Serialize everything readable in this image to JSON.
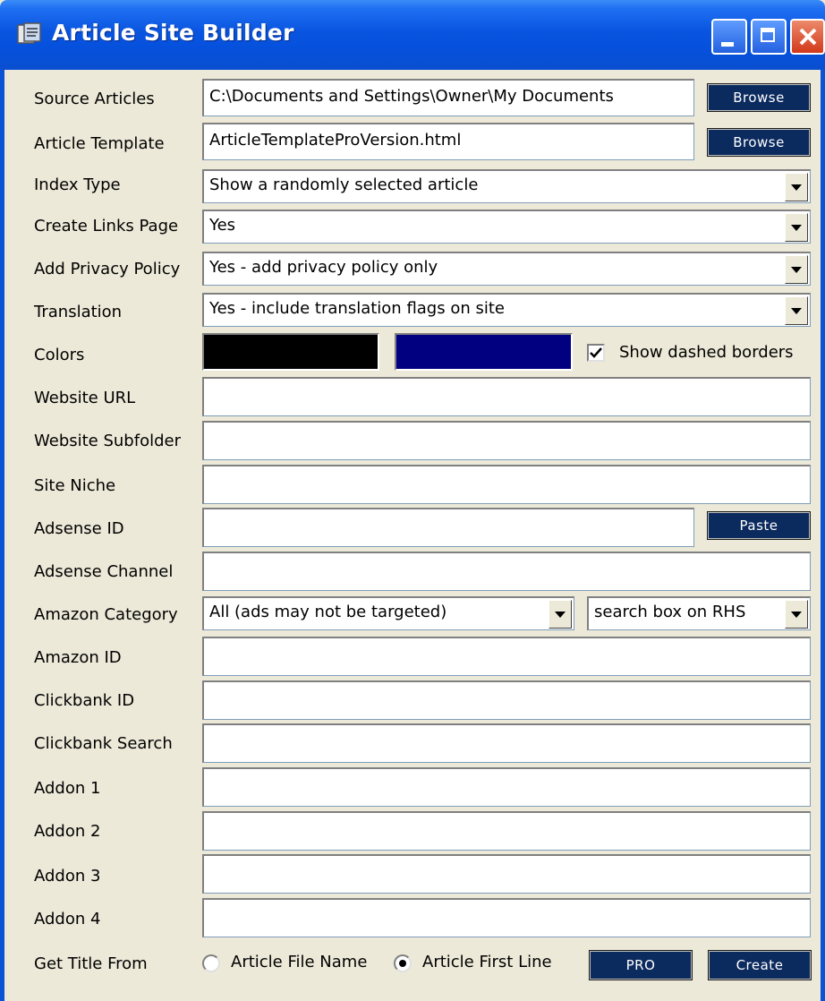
{
  "window": {
    "title": "Article Site Builder"
  },
  "labels": {
    "source_articles": "Source Articles",
    "article_template": "Article Template",
    "index_type": "Index Type",
    "create_links_page": "Create Links Page",
    "add_privacy_policy": "Add Privacy Policy",
    "translation": "Translation",
    "colors": "Colors",
    "website_url": "Website URL",
    "website_subfolder": "Website Subfolder",
    "site_niche": "Site Niche",
    "adsense_id": "Adsense ID",
    "adsense_channel": "Adsense Channel",
    "amazon_category": "Amazon Category",
    "amazon_id": "Amazon ID",
    "clickbank_id": "Clickbank ID",
    "clickbank_search": "Clickbank Search",
    "addon1": "Addon 1",
    "addon2": "Addon 2",
    "addon3": "Addon 3",
    "addon4": "Addon 4",
    "get_title_from": "Get Title From"
  },
  "values": {
    "source_articles": "C:\\Documents and Settings\\Owner\\My Documents",
    "article_template": "ArticleTemplateProVersion.html",
    "index_type": "Show a randomly selected article",
    "create_links_page": "Yes",
    "add_privacy_policy": "Yes - add privacy policy only",
    "translation": "Yes - include translation flags on site",
    "website_url": "",
    "website_subfolder": "",
    "site_niche": "",
    "adsense_id": "",
    "adsense_channel": "",
    "amazon_category": "All (ads may not be targeted)",
    "amazon_search_position": "search box on RHS",
    "amazon_id": "",
    "clickbank_id": "",
    "clickbank_search": "",
    "addon1": "",
    "addon2": "",
    "addon3": "",
    "addon4": ""
  },
  "colors": {
    "color1": "#000000",
    "color2": "#000080",
    "button_bg": "#0b2a5e",
    "window_bg": "#ece9d8"
  },
  "checkbox": {
    "label": "Show dashed borders",
    "checked": true
  },
  "get_title": {
    "option1": "Article File Name",
    "option2": "Article First Line",
    "selected": "Article First Line"
  },
  "buttons": {
    "browse": "Browse",
    "paste": "Paste",
    "pro": "PRO",
    "create": "Create"
  }
}
